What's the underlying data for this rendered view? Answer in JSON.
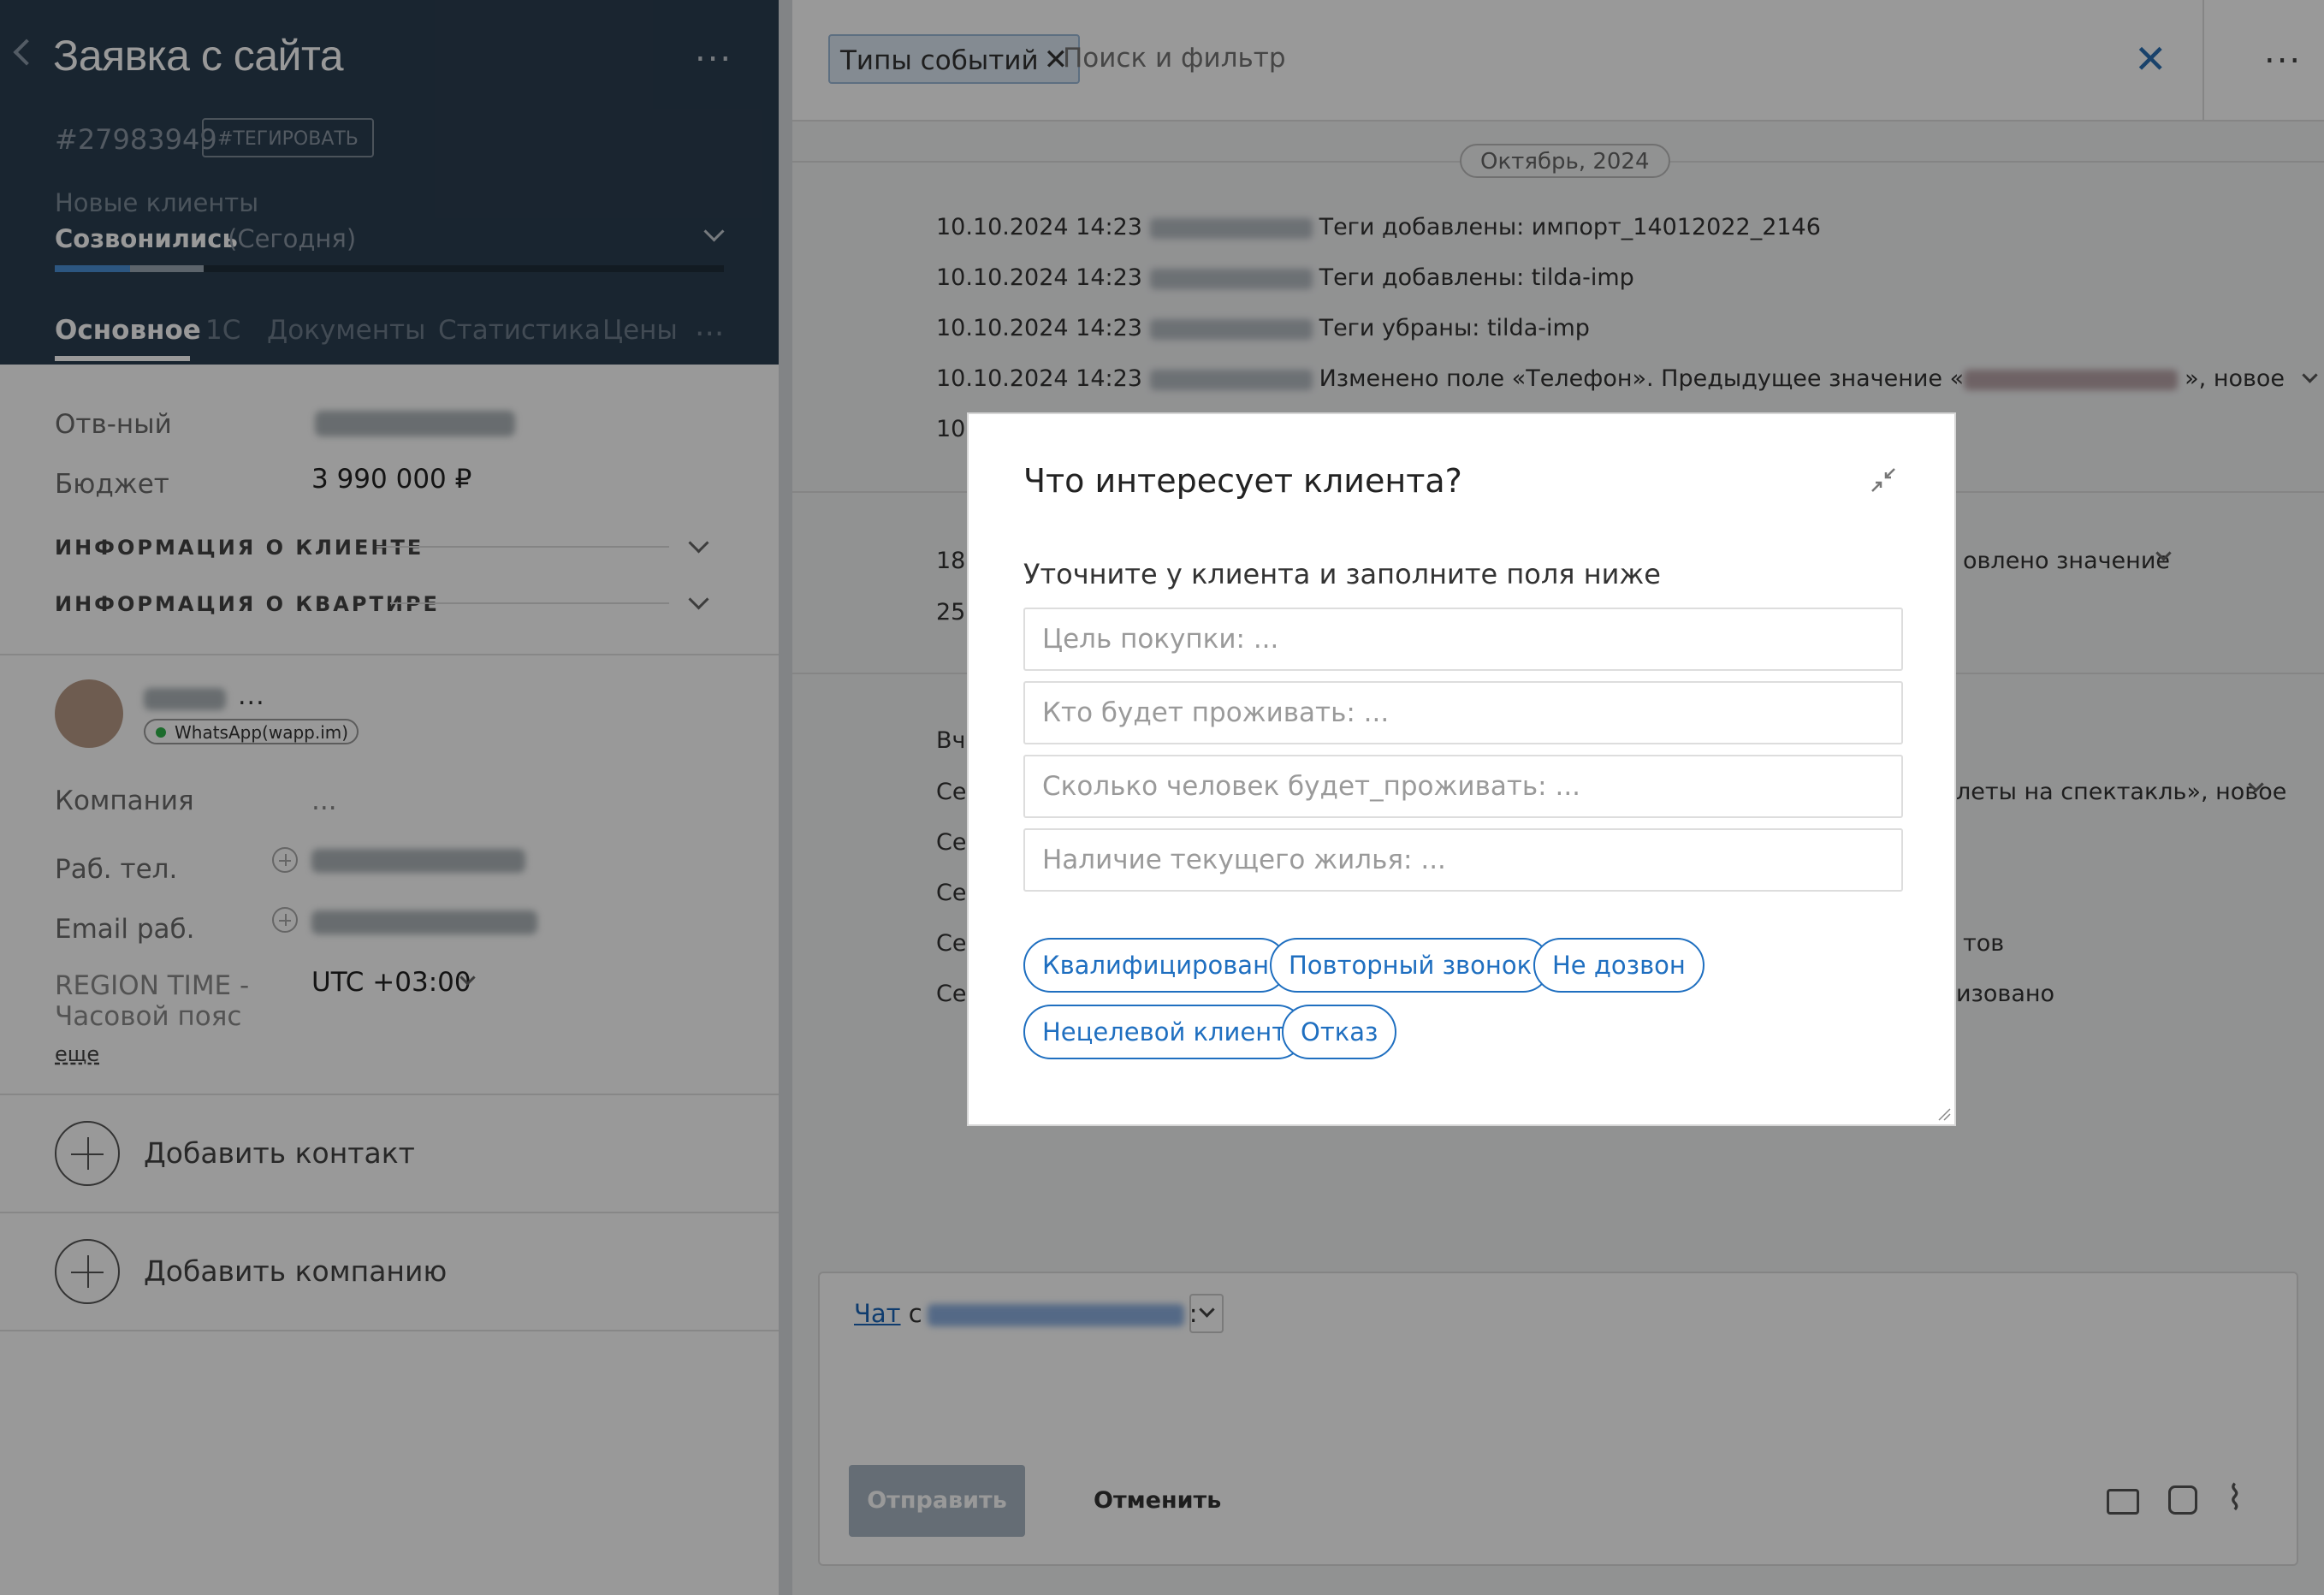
{
  "lead": {
    "title": "Заявка с сайта",
    "id": "#27983949",
    "tag_button": "#ТЕГИРОВАТЬ",
    "pipeline": "Новые клиенты",
    "stage": "Созвонились",
    "stage_date": "(Сегодня)",
    "tabs": [
      "Основное",
      "1С",
      "Документы",
      "Статистика",
      "Цены"
    ],
    "fields": {
      "responsible_label": "Отв-ный",
      "budget_label": "Бюджет",
      "budget_value": "3 990 000  ₽"
    },
    "sections": [
      "ИНФОРМАЦИЯ О КЛИЕНТЕ",
      "ИНФОРМАЦИЯ О КВАРТИРЕ"
    ],
    "contact": {
      "channel": "WhatsApp(wapp.im)",
      "company_label": "Компания",
      "company_value": "...",
      "work_phone_label": "Раб. тел.",
      "work_email_label": "Email раб.",
      "region_time_label": "REGION TIME - Часовой пояс",
      "region_time_value": "UTC +03:00",
      "more_link": "еще"
    },
    "add_contact": "Добавить контакт",
    "add_company": "Добавить компанию"
  },
  "feed": {
    "filter_chip": "Типы событий",
    "search_placeholder": "Поиск и фильтр",
    "date_divider": "Октябрь, 2024",
    "events": [
      {
        "time": "10.10.2024 14:23",
        "text": "Теги добавлены: импорт_14012022_2146"
      },
      {
        "time": "10.10.2024 14:23",
        "text": "Теги добавлены: tilda-imp"
      },
      {
        "time": "10.10.2024 14:23",
        "text": "Теги убраны: tilda-imp"
      },
      {
        "time": "10.10.2024 14:23",
        "text": "Изменено поле «Телефон». Предыдущее значение «",
        "tail": "», новое"
      },
      {
        "time": "10",
        "text": ""
      }
    ],
    "partial_rows": [
      {
        "left": "18",
        "right": "овлено значение"
      },
      {
        "left": "25",
        "right": ""
      },
      {
        "left": "Вче",
        "right": ""
      },
      {
        "left": "Сеі",
        "right": "леты на спектакль», новое"
      },
      {
        "left": "Сеі",
        "right": ""
      },
      {
        "left": "Сеі",
        "right": ""
      },
      {
        "left": "Сеі",
        "right": "тов"
      },
      {
        "left": "Сеі",
        "right": "изовано"
      }
    ],
    "chat": {
      "link": "Чат",
      "with": "с",
      "send": "Отправить",
      "cancel": "Отменить"
    }
  },
  "modal": {
    "title": "Что интересует клиента?",
    "subtitle": "Уточните у клиента и заполните поля ниже",
    "fields": [
      "Цель покупки: ...",
      "Кто будет проживать: ...",
      "Сколько человек будет_проживать: ...",
      "Наличие текущего жилья: ..."
    ],
    "chips": [
      "Квалифицирован",
      "Повторный звонок",
      "Не дозвон",
      "Нецелевой клиент",
      "Отказ"
    ]
  },
  "colors": {
    "header_bg": "#2b3e50",
    "accent": "#1f6fc0",
    "overlay": "rgba(0,0,0,0.4)"
  }
}
